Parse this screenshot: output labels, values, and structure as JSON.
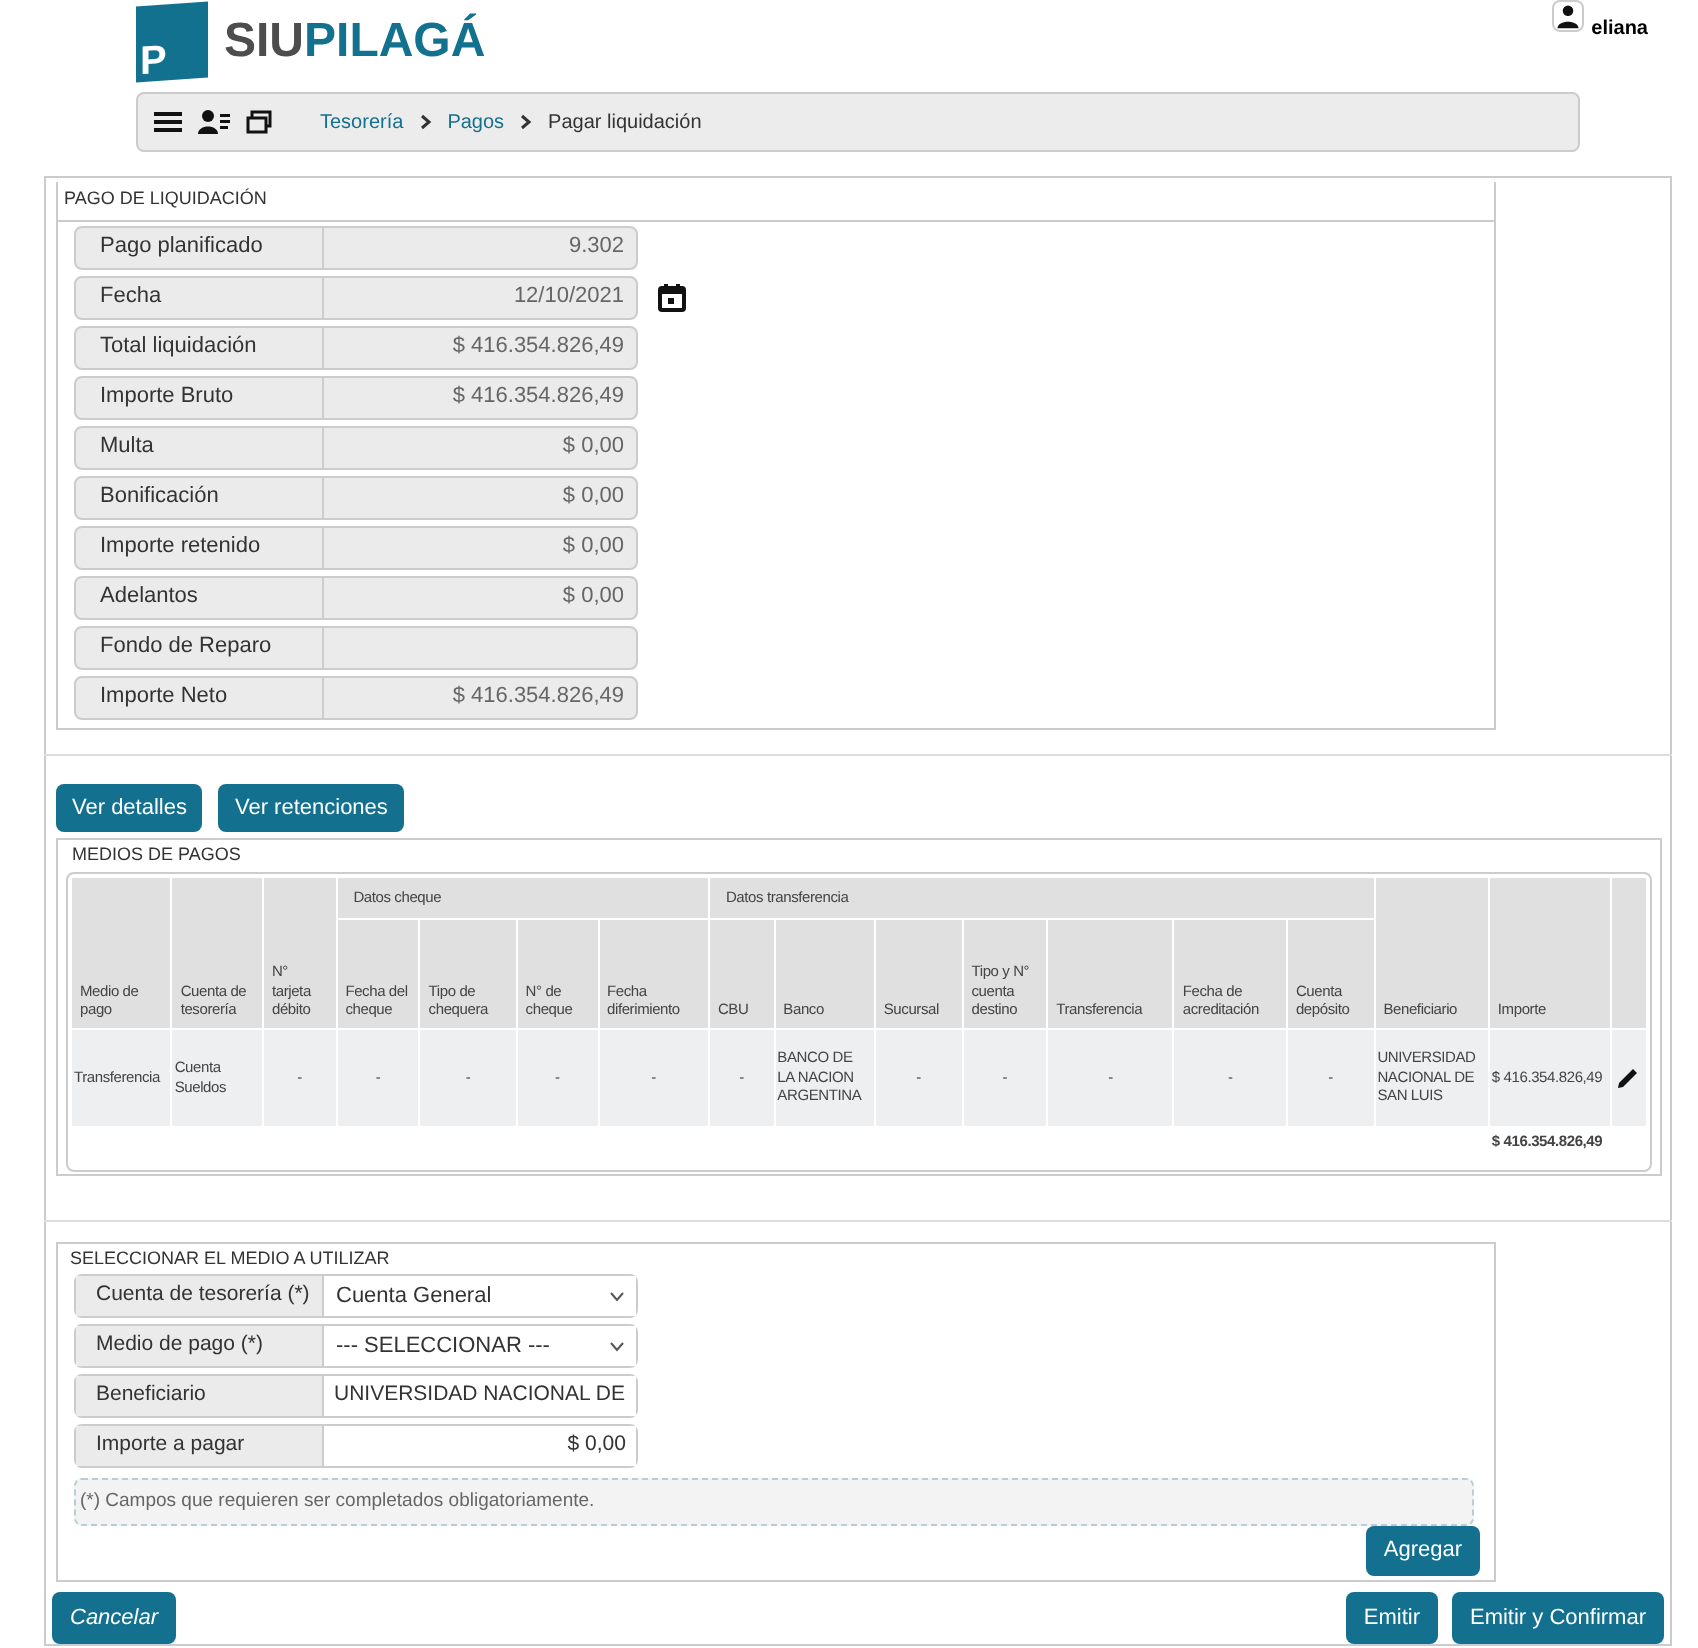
{
  "header": {
    "logo_prefix": "SIU",
    "logo_name": "PILAGÁ",
    "logo_letter": "P",
    "user": "eliana"
  },
  "breadcrumb": [
    {
      "label": "Tesorería",
      "kind": "link"
    },
    {
      "label": "Pagos",
      "kind": "link"
    },
    {
      "label": "Pagar liquidación",
      "kind": "current"
    }
  ],
  "pago": {
    "title": "PAGO DE LIQUIDACIÓN",
    "fields": [
      {
        "label": "Pago planificado",
        "value": "9.302"
      },
      {
        "label": "Fecha",
        "value": "12/10/2021",
        "kind": "date"
      },
      {
        "label": "Total liquidación",
        "value": "$ 416.354.826,49"
      },
      {
        "label": "Importe Bruto",
        "value": "$ 416.354.826,49"
      },
      {
        "label": "Multa",
        "value": "$ 0,00"
      },
      {
        "label": "Bonificación",
        "value": "$ 0,00"
      },
      {
        "label": "Importe retenido",
        "value": "$ 0,00"
      },
      {
        "label": "Adelantos",
        "value": "$ 0,00"
      },
      {
        "label": "Fondo de Reparo"
      },
      {
        "label": "Importe Neto",
        "value": "$ 416.354.826,49"
      }
    ]
  },
  "actions": [
    "Ver detalles",
    "Ver retenciones"
  ],
  "medios": {
    "title": "MEDIOS DE PAGOS",
    "column_groups": [
      {
        "kind": "cheque",
        "label": "Datos cheque"
      },
      {
        "kind": "transfer",
        "label": "Datos transferencia"
      }
    ],
    "columns": [
      {
        "label": "Medio de pago"
      },
      {
        "label": "Cuenta de tesorería"
      },
      {
        "label": "N° tarjeta débito"
      },
      {
        "label": "Fecha del cheque",
        "kind": "cheque"
      },
      {
        "label": "Tipo de chequera",
        "kind": "cheque"
      },
      {
        "label": "N° de cheque",
        "kind": "cheque"
      },
      {
        "label": "Fecha diferimiento",
        "kind": "cheque"
      },
      {
        "label": "CBU",
        "kind": "transfer"
      },
      {
        "label": "Banco",
        "kind": "transfer"
      },
      {
        "label": "Sucursal",
        "kind": "transfer"
      },
      {
        "label": "Tipo y N° cuenta destino",
        "kind": "transfer"
      },
      {
        "label": "Transferencia",
        "kind": "transfer"
      },
      {
        "label": "Fecha de acreditación",
        "kind": "transfer"
      },
      {
        "label": "Cuenta depósito",
        "kind": "transfer"
      },
      {
        "label": "Beneficiario"
      },
      {
        "label": "Importe"
      }
    ],
    "rows": [
      {
        "cells": [
          "Transferencia",
          "Cuenta Sueldos",
          "-",
          "-",
          "-",
          "-",
          "-",
          "-",
          "BANCO DE LA NACION ARGENTINA",
          "-",
          "-",
          "-",
          "-",
          "-",
          "UNIVERSIDAD NACIONAL DE SAN LUIS",
          "$ 416.354.826,49"
        ]
      }
    ],
    "total": "$ 416.354.826,49"
  },
  "seleccionar": {
    "title": "SELECCIONAR EL MEDIO A UTILIZAR",
    "fields": [
      {
        "label": "Cuenta de tesorería (*)",
        "value": "Cuenta General",
        "kind": "select"
      },
      {
        "label": "Medio de pago (*)",
        "value": "--- SELECCIONAR ---",
        "kind": "select"
      },
      {
        "label": "Beneficiario",
        "value": "UNIVERSIDAD NACIONAL DE",
        "kind": "text"
      },
      {
        "label": "Importe a pagar",
        "value": "$ 0,00",
        "kind": "amount"
      }
    ],
    "note": "(*) Campos que requieren ser completados obligatoriamente.",
    "add": "Agregar"
  },
  "footer": {
    "cancel": "Cancelar",
    "buttons": [
      {
        "label": "Emitir"
      },
      {
        "label": "Emitir y Confirmar"
      }
    ]
  }
}
